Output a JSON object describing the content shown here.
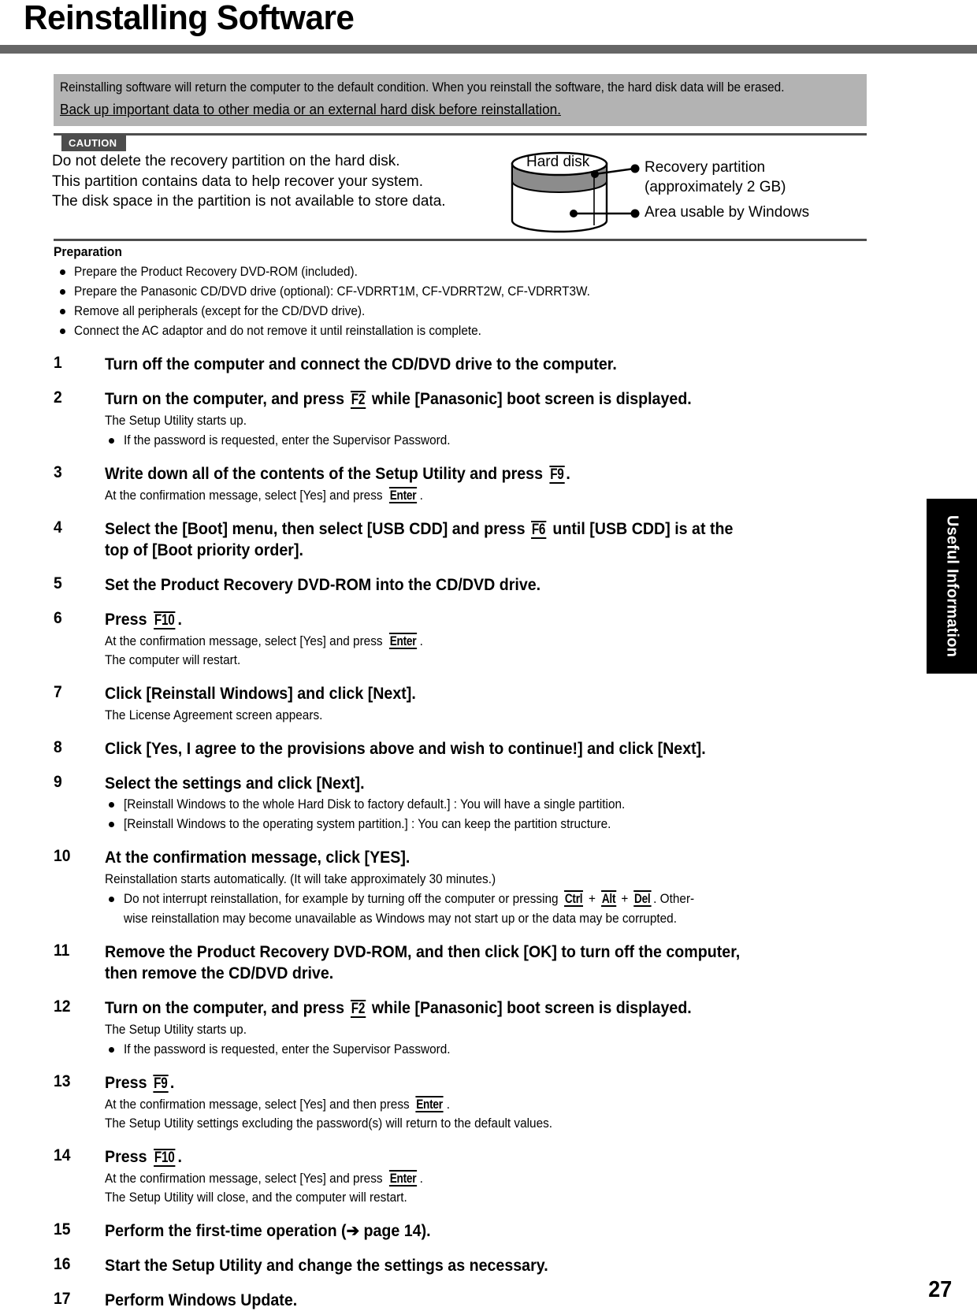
{
  "page": {
    "title": "Reinstalling Software",
    "number": "27",
    "side_tab": "Useful Information"
  },
  "banner": {
    "line1": "Reinstalling software will return the computer to the default condition. When you reinstall the software, the hard disk data will be erased.",
    "line2": "Back up important data to other media or an external hard disk before reinstallation."
  },
  "caution": {
    "tag": "CAUTION",
    "lines": [
      "Do not delete the recovery partition on the hard disk.",
      "This partition contains data to help recover your system.",
      "The disk space in the partition is not available to store data."
    ]
  },
  "diagram": {
    "disk_label": "Hard disk",
    "callout_recovery_line1": "Recovery partition",
    "callout_recovery_line2": "(approximately 2 GB)",
    "callout_windows": "Area usable by Windows"
  },
  "preparation": {
    "heading": "Preparation",
    "items": [
      "Prepare the Product Recovery DVD-ROM (included).",
      "Prepare the Panasonic CD/DVD drive (optional): CF-VDRRT1M, CF-VDRRT2W, CF-VDRRT3W.",
      "Remove all peripherals (except for the CD/DVD drive).",
      "Connect the AC adaptor and do not remove it until reinstallation is complete."
    ]
  },
  "steps": {
    "s1": {
      "num": "1",
      "title": "Turn off the computer and connect the CD/DVD drive to the computer."
    },
    "s2": {
      "num": "2",
      "title_a": "Turn on the computer, and press",
      "key": "F2",
      "title_b": "while [Panasonic] boot screen is displayed.",
      "sub1": "The Setup Utility starts up.",
      "bullet1": "If the password is requested, enter the Supervisor Password."
    },
    "s3": {
      "num": "3",
      "title_a": "Write down all of the contents of the Setup Utility and press",
      "key": "F9",
      "title_b": ".",
      "sub_a": "At the confirmation message, select [Yes] and press",
      "sub_key": "Enter",
      "sub_b": "."
    },
    "s4": {
      "num": "4",
      "title_a": "Select the [Boot] menu, then select [USB CDD] and press",
      "key": "F6",
      "title_b": "until [USB CDD] is at the",
      "title_line2": "top of [Boot priority order]."
    },
    "s5": {
      "num": "5",
      "title": "Set the Product Recovery DVD-ROM into the CD/DVD drive."
    },
    "s6": {
      "num": "6",
      "title_a": "Press",
      "key": "F10",
      "title_b": ".",
      "sub_a": "At the confirmation message, select [Yes] and press",
      "sub_key": "Enter",
      "sub_b": ".",
      "sub2": "The computer will restart."
    },
    "s7": {
      "num": "7",
      "title": "Click [Reinstall Windows] and click [Next].",
      "sub1": "The License Agreement screen appears."
    },
    "s8": {
      "num": "8",
      "title": "Click [Yes, I agree to the provisions above and wish to continue!] and click [Next]."
    },
    "s9": {
      "num": "9",
      "title": "Select the settings and click [Next].",
      "bullet1": "[Reinstall Windows to the whole Hard Disk to factory default.] : You will have a single partition.",
      "bullet2": "[Reinstall Windows to the operating system partition.] : You can keep the partition structure."
    },
    "s10": {
      "num": "10",
      "title": "At the confirmation message, click [YES].",
      "sub1": "Reinstallation starts automatically. (It will take approximately 30 minutes.)",
      "bullet_a": "Do not interrupt reinstallation, for example by turning off the computer or pressing",
      "key1": "Ctrl",
      "plus1": "+",
      "key2": "Alt",
      "plus2": "+",
      "key3": "Del",
      "bullet_b": ". Other-",
      "bullet_line2": "wise reinstallation may become unavailable as Windows may not start up or the data may be corrupted."
    },
    "s11": {
      "num": "11",
      "title_line1": "Remove the Product Recovery DVD-ROM, and then click [OK] to turn off the computer,",
      "title_line2": "then remove the CD/DVD drive."
    },
    "s12": {
      "num": "12",
      "title_a": "Turn on the computer, and press",
      "key": "F2",
      "title_b": "while [Panasonic] boot screen is displayed.",
      "sub1": "The Setup Utility starts up.",
      "bullet1": "If the password is requested, enter the Supervisor Password."
    },
    "s13": {
      "num": "13",
      "title_a": "Press",
      "key": "F9",
      "title_b": ".",
      "sub_a": "At the confirmation message, select [Yes] and then press",
      "sub_key": "Enter",
      "sub_b": ".",
      "sub2": "The Setup Utility settings excluding the password(s) will return to the default values."
    },
    "s14": {
      "num": "14",
      "title_a": "Press",
      "key": "F10",
      "title_b": ".",
      "sub_a": "At the confirmation message, select [Yes] and press",
      "sub_key": "Enter",
      "sub_b": ".",
      "sub2": "The Setup Utility will close, and the computer will restart."
    },
    "s15": {
      "num": "15",
      "title_a": "Perform the first-time operation (",
      "arrow": "➔",
      "title_b": " page 14)."
    },
    "s16": {
      "num": "16",
      "title": "Start the Setup Utility and change the settings as necessary."
    },
    "s17": {
      "num": "17",
      "title": "Perform Windows Update."
    }
  },
  "colors": {
    "rule_gray": "#666666",
    "banner_gray": "#b3b3b3",
    "caution_dark": "#4d4d4d",
    "tab_black": "#000000"
  }
}
